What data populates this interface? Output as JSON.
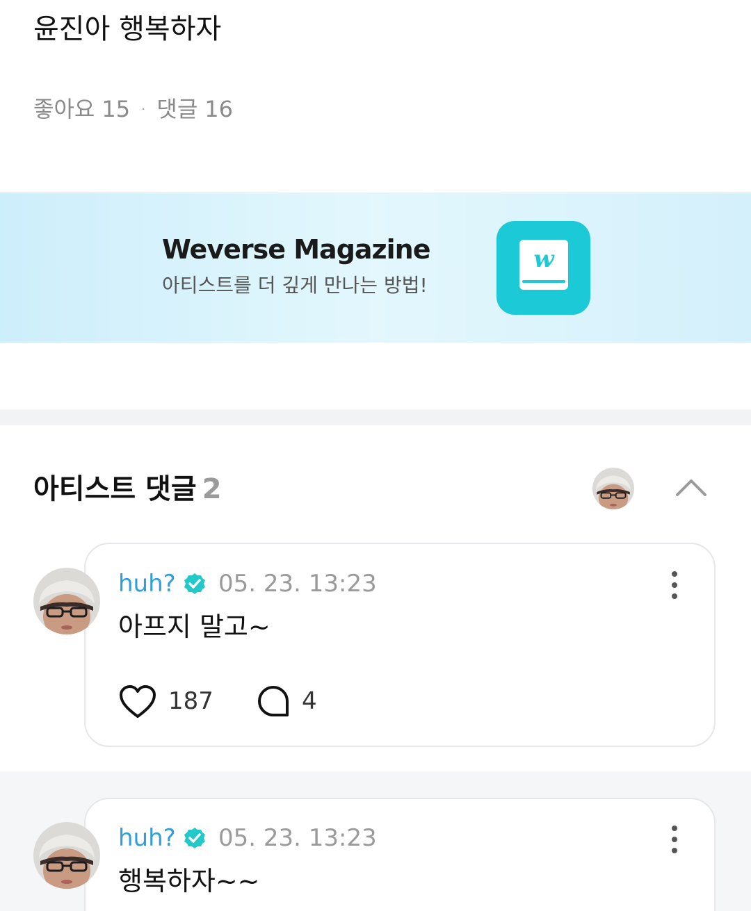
{
  "post": {
    "title": "윤진아 행복하자",
    "likes_label": "좋아요",
    "likes_count": "15",
    "separator": "·",
    "comments_label": "댓글",
    "comments_count": "16"
  },
  "banner": {
    "title": "Weverse Magazine",
    "subtitle": "아티스트를 더 깊게 만나는 방법!",
    "app_icon": "weverse-magazine-book-icon",
    "app_letter": "w",
    "colors": {
      "background": "#d9f3fc",
      "app": "#1cc9d6"
    }
  },
  "artist_comments": {
    "title": "아티스트 댓글",
    "count": "2",
    "collapse_icon": "chevron-up-icon"
  },
  "comments": [
    {
      "author": "huh?",
      "verified_icon": "verified-badge-icon",
      "time": "05. 23. 13:23",
      "text": "아프지 말고~",
      "likes": "187",
      "replies": "4"
    },
    {
      "author": "huh?",
      "verified_icon": "verified-badge-icon",
      "time": "05. 23. 13:23",
      "text": "행복하자~~"
    }
  ],
  "colors": {
    "author": "#2f9ed9",
    "verified": "#23c8c9",
    "muted": "#8a8a8a"
  }
}
